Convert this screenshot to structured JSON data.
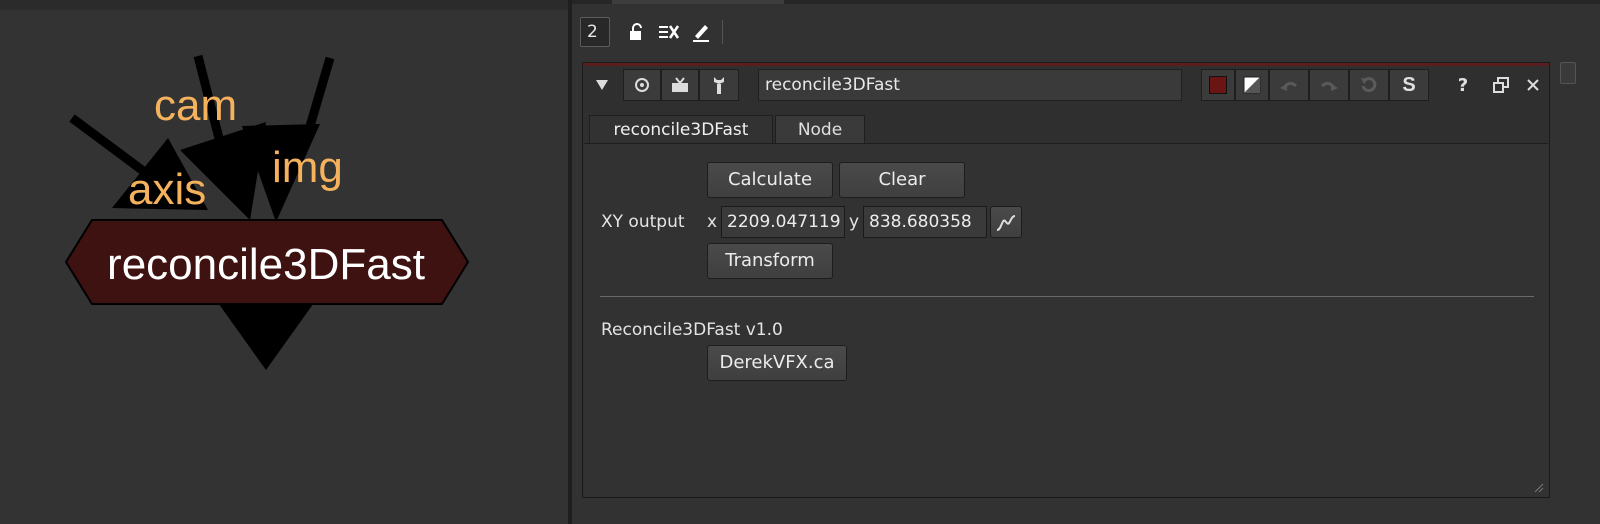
{
  "node_graph": {
    "inputs": {
      "cam": "cam",
      "img": "img",
      "axis": "axis"
    },
    "node_label": "reconcile3DFast",
    "colors": {
      "node_fill": "#3f1212",
      "input_label": "#f5b25d",
      "node_text": "#ffffff"
    }
  },
  "toolbar": {
    "max_panels_value": "2",
    "icons": [
      "lock-icon",
      "clear-panels-icon",
      "edit-icon"
    ]
  },
  "panel": {
    "header": {
      "icons": [
        "collapse-triangle-icon",
        "center-node-icon",
        "viewer-icon",
        "wrench-icon"
      ],
      "node_name": "reconcile3DFast",
      "right_icons": [
        "node-color-icon",
        "tile-color-icon",
        "undo-icon",
        "redo-icon",
        "revert-icon",
        "script-s-icon",
        "help-icon",
        "float-icon",
        "close-icon"
      ]
    },
    "tabs": [
      {
        "label": "reconcile3DFast"
      },
      {
        "label": "Node"
      }
    ],
    "controls": {
      "calculate_label": "Calculate",
      "clear_label": "Clear",
      "xy_output_label": "XY output",
      "x_label": "x",
      "x_value": "2209.047119",
      "y_label": "y",
      "y_value": "838.680358",
      "transform_label": "Transform",
      "version_label": "Reconcile3DFast v1.0",
      "website_label": "DerekVFX.ca"
    }
  }
}
